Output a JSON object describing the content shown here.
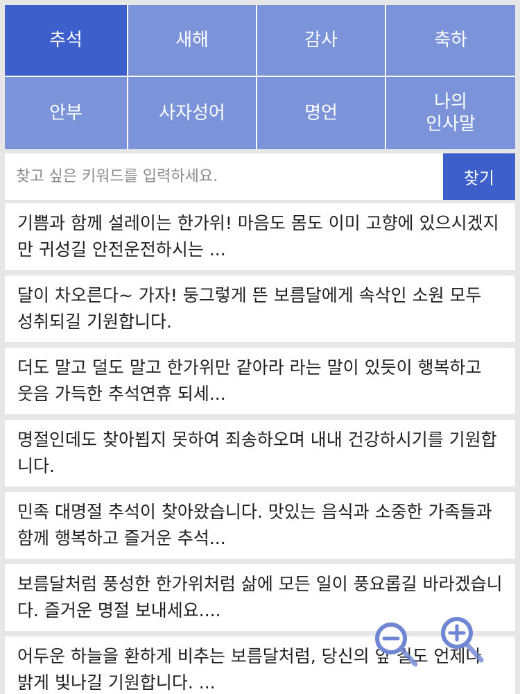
{
  "categories": [
    {
      "label": "추석",
      "active": true
    },
    {
      "label": "새해",
      "active": false
    },
    {
      "label": "감사",
      "active": false
    },
    {
      "label": "축하",
      "active": false
    },
    {
      "label": "안부",
      "active": false
    },
    {
      "label": "사자성어",
      "active": false
    },
    {
      "label": "명언",
      "active": false
    },
    {
      "label": "나의\n인사말",
      "active": false
    }
  ],
  "search": {
    "placeholder": "찾고 싶은 키워드를 입력하세요.",
    "button_label": "찾기"
  },
  "messages": [
    "기쁨과 함께 설레이는 한가위! 마음도 몸도 이미 고향에 있으시겠지만 귀성길 안전운전하시는 ...",
    "달이 차오른다~ 가자! 둥그렇게 뜬 보름달에게 속삭인 소원 모두 성취되길 기원합니다.",
    "더도 말고 덜도 말고 한가위만 같아라 라는 말이 있듯이 행복하고 웃음 가득한 추석연휴 되세...",
    "명절인데도 찾아뵙지 못하여 죄송하오며 내내 건강하시기를 기원합니다.",
    "민족 대명절 추석이 찾아왔습니다. 맛있는 음식과 소중한 가족들과 함께 행복하고 즐거운 추석...",
    "보름달처럼 풍성한 한가위처럼 삶에 모든 일이 풍요롭길 바라겠습니다. 즐거운 명절 보내세요....",
    "어두운 하늘을 환하게 비추는 보름달처럼, 당신의 앞 길도 언제나 밝게 빛나길 기원합니다. ..."
  ],
  "zoom": {
    "zoom_out_icon": "zoom-out-icon",
    "zoom_in_icon": "zoom-in-icon"
  },
  "colors": {
    "active": "#3d5fcb",
    "inactive": "#7b93d8",
    "background": "#e6e6e6"
  }
}
